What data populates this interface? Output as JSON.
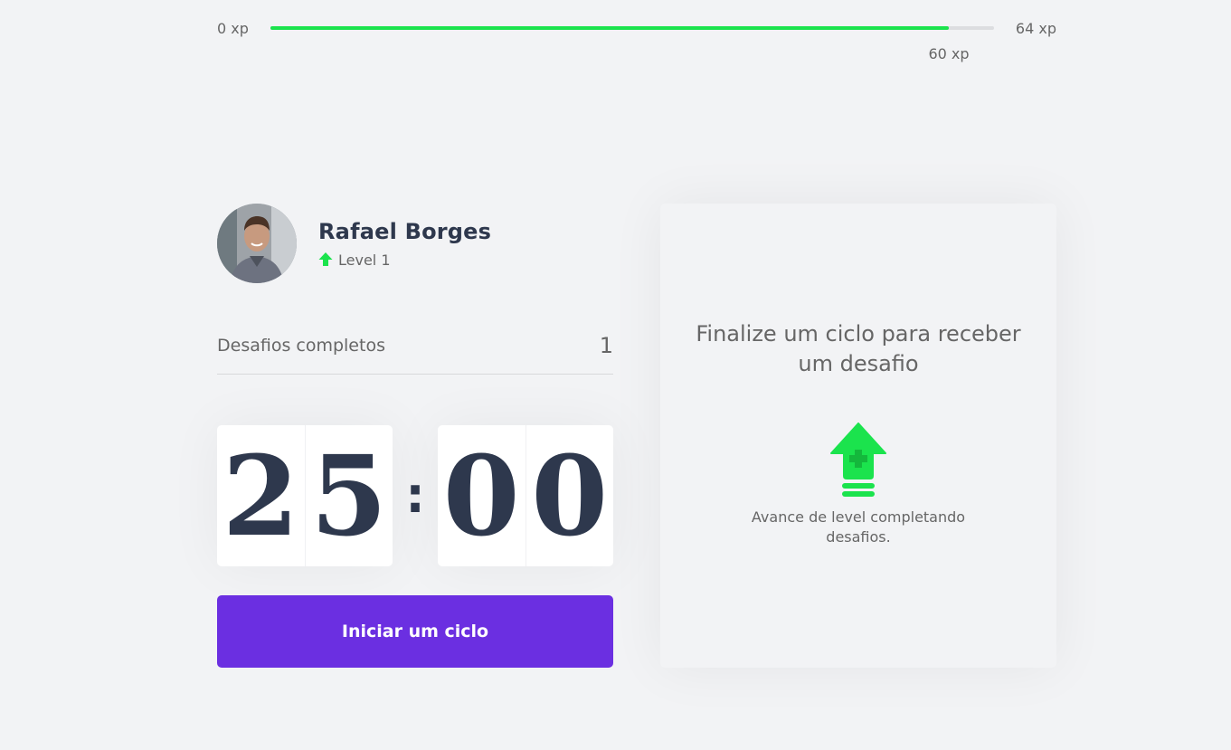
{
  "xp": {
    "min_label": "0 xp",
    "max_label": "64 xp",
    "current_label": "60 xp",
    "current": 60,
    "max": 64
  },
  "profile": {
    "name": "Rafael Borges",
    "level_label": "Level 1",
    "avatar_icon": "user-photo"
  },
  "challenges": {
    "label": "Desafios completos",
    "count": "1"
  },
  "countdown": {
    "minute_tens": "2",
    "minute_units": "5",
    "separator": ":",
    "second_tens": "0",
    "second_units": "0"
  },
  "start_button": {
    "label": "Iniciar um ciclo"
  },
  "challenge_box": {
    "title": "Finalize um ciclo para receber um desafio",
    "hint": "Avance de level completando desafios.",
    "icon": "level-up-icon"
  },
  "colors": {
    "accent": "#6b2fe1",
    "green": "#1be34d",
    "title": "#2e384d",
    "text": "#666666",
    "background": "#f2f3f5"
  }
}
